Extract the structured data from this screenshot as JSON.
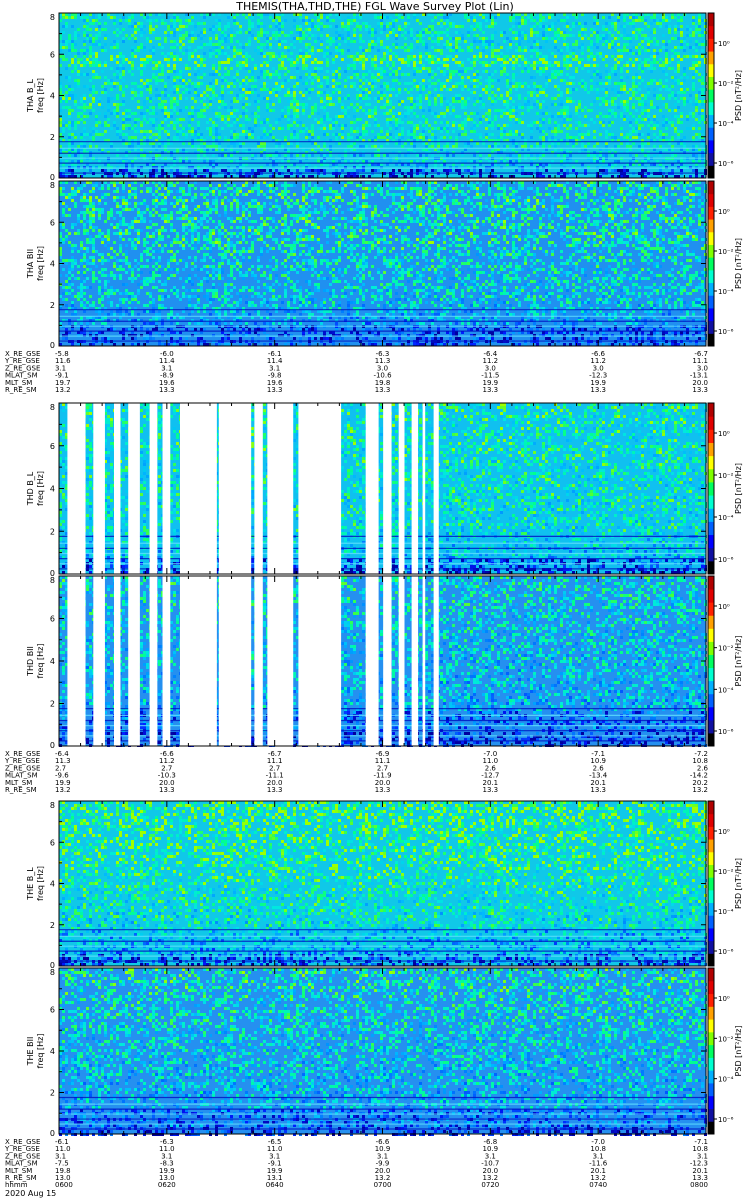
{
  "title": "THEMIS(THA,THD,THE) FGL Wave Survey Plot (Lin)",
  "date_label": "2020 Aug 15",
  "colorbar": {
    "label": "PSD [nT²/Hz]",
    "colors": [
      "#000000",
      "#1010a0",
      "#0000ff",
      "#0060ff",
      "#00b0ff",
      "#00ffd0",
      "#00ff60",
      "#80ff00",
      "#ffff00",
      "#ffa000",
      "#ff2000",
      "#e00000",
      "#b00000"
    ]
  },
  "time_axis": {
    "ticks": [
      "0600",
      "0620",
      "0640",
      "0700",
      "0720",
      "0740",
      "0800"
    ],
    "label": "hhmm"
  },
  "chart_data": [
    {
      "type": "heatmap",
      "panel": "THA B_L",
      "ylabel": "THA B_L freq [Hz]",
      "ylabel_top": "THA B_L",
      "ylabel_bottom": "freq [Hz]",
      "yticks": [
        "0",
        "2",
        "4",
        "6",
        "8"
      ],
      "ylim": [
        0,
        8
      ],
      "zticks": [
        "10⁰",
        "10⁻²",
        "10⁻⁴",
        "10⁻⁶"
      ],
      "zscale": "log",
      "style": "tha_bl",
      "bg": "#10c8e8",
      "gaps": []
    },
    {
      "type": "heatmap",
      "panel": "THA BII",
      "ylabel": "THA BII freq [Hz]",
      "ylabel_top": "THA BII",
      "ylabel_bottom": "freq [Hz]",
      "yticks": [
        "0",
        "2",
        "4",
        "6",
        "8"
      ],
      "ylim": [
        0,
        8
      ],
      "zticks": [
        "10⁰",
        "10⁻²",
        "10⁻⁴",
        "10⁻⁶"
      ],
      "zscale": "log",
      "style": "tha_bii",
      "bg": "#2090f0",
      "gaps": []
    },
    {
      "type": "heatmap",
      "panel": "THD B_L",
      "ylabel": "THD B_L freq [Hz]",
      "ylabel_top": "THD B_L",
      "ylabel_bottom": "freq [Hz]",
      "yticks": [
        "0",
        "2",
        "4",
        "6",
        "8"
      ],
      "ylim": [
        0,
        8
      ],
      "zticks": [
        "10⁰",
        "10⁻²",
        "10⁻⁴",
        "10⁻⁶"
      ],
      "zscale": "log",
      "style": "thd_bl",
      "bg": "#10c0f0",
      "gaps": [
        [
          0.013,
          0.041
        ],
        [
          0.053,
          0.071
        ],
        [
          0.085,
          0.095
        ],
        [
          0.107,
          0.125
        ],
        [
          0.14,
          0.152
        ],
        [
          0.16,
          0.172
        ],
        [
          0.187,
          0.244
        ],
        [
          0.247,
          0.297
        ],
        [
          0.302,
          0.315
        ],
        [
          0.322,
          0.362
        ],
        [
          0.37,
          0.436
        ],
        [
          0.474,
          0.494
        ],
        [
          0.501,
          0.514
        ],
        [
          0.525,
          0.534
        ],
        [
          0.545,
          0.555
        ],
        [
          0.562,
          0.566
        ],
        [
          0.579,
          0.587
        ]
      ]
    },
    {
      "type": "heatmap",
      "panel": "THD BII",
      "ylabel": "THD BII freq [Hz]",
      "ylabel_top": "THD BII",
      "ylabel_bottom": "freq [Hz]",
      "yticks": [
        "0",
        "2",
        "4",
        "6",
        "8"
      ],
      "ylim": [
        0,
        8
      ],
      "zticks": [
        "10⁰",
        "10⁻²",
        "10⁻⁴",
        "10⁻⁶"
      ],
      "zscale": "log",
      "style": "thd_bii",
      "bg": "#2590f0",
      "gaps": [
        [
          0.013,
          0.041
        ],
        [
          0.053,
          0.071
        ],
        [
          0.085,
          0.095
        ],
        [
          0.107,
          0.125
        ],
        [
          0.14,
          0.152
        ],
        [
          0.16,
          0.172
        ],
        [
          0.187,
          0.244
        ],
        [
          0.247,
          0.297
        ],
        [
          0.302,
          0.315
        ],
        [
          0.322,
          0.362
        ],
        [
          0.37,
          0.436
        ],
        [
          0.474,
          0.494
        ],
        [
          0.501,
          0.514
        ],
        [
          0.525,
          0.534
        ],
        [
          0.545,
          0.555
        ],
        [
          0.562,
          0.566
        ],
        [
          0.579,
          0.587
        ]
      ]
    },
    {
      "type": "heatmap",
      "panel": "THE B_L",
      "ylabel": "THE B_L freq [Hz]",
      "ylabel_top": "THE B_L",
      "ylabel_bottom": "freq [Hz]",
      "yticks": [
        "0",
        "2",
        "4",
        "6",
        "8"
      ],
      "ylim": [
        0,
        8
      ],
      "zticks": [
        "10⁰",
        "10⁻²",
        "10⁻⁴",
        "10⁻⁶"
      ],
      "zscale": "log",
      "style": "the_bl",
      "bg": "#10c8e8",
      "gaps": []
    },
    {
      "type": "heatmap",
      "panel": "THE BII",
      "ylabel": "THE BII freq [Hz]",
      "ylabel_top": "THE BII",
      "ylabel_bottom": "freq [Hz]",
      "yticks": [
        "0",
        "2",
        "4",
        "6",
        "8"
      ],
      "ylim": [
        0,
        8
      ],
      "zticks": [
        "10⁰",
        "10⁻²",
        "10⁻⁴",
        "10⁻⁶"
      ],
      "zscale": "log",
      "style": "the_bii",
      "bg": "#2590f0",
      "gaps": []
    }
  ],
  "ephemeris": [
    {
      "rows": [
        {
          "label": "X_RE_GSE",
          "values": [
            "-5.8",
            "-6.0",
            "-6.1",
            "-6.3",
            "-6.4",
            "-6.6",
            "-6.7"
          ]
        },
        {
          "label": "Y_RE_GSE",
          "values": [
            "11.6",
            "11.4",
            "11.4",
            "11.3",
            "11.2",
            "11.2",
            "11.1"
          ]
        },
        {
          "label": "Z_RE_GSE",
          "values": [
            "3.1",
            "3.1",
            "3.1",
            "3.0",
            "3.0",
            "3.0",
            "3.0"
          ]
        },
        {
          "label": "MLAT_SM",
          "values": [
            "-9.1",
            "-8.9",
            "-9.8",
            "-10.6",
            "-11.5",
            "-12.3",
            "-13.1"
          ]
        },
        {
          "label": "MLT_SM",
          "values": [
            "19.7",
            "19.6",
            "19.6",
            "19.8",
            "19.9",
            "19.9",
            "20.0"
          ]
        },
        {
          "label": "R_RE_SM",
          "values": [
            "13.2",
            "13.3",
            "13.3",
            "13.3",
            "13.3",
            "13.3",
            "13.3"
          ]
        }
      ]
    },
    {
      "rows": [
        {
          "label": "X_RE_GSE",
          "values": [
            "-6.4",
            "-6.6",
            "-6.7",
            "-6.9",
            "-7.0",
            "-7.1",
            "-7.2"
          ]
        },
        {
          "label": "Y_RE_GSE",
          "values": [
            "11.3",
            "11.2",
            "11.1",
            "11.1",
            "11.0",
            "10.9",
            "10.8"
          ]
        },
        {
          "label": "Z_RE_GSE",
          "values": [
            "2.7",
            "2.7",
            "2.7",
            "2.7",
            "2.6",
            "2.6",
            "2.6"
          ]
        },
        {
          "label": "MLAT_SM",
          "values": [
            "-9.6",
            "-10.3",
            "-11.1",
            "-11.9",
            "-12.7",
            "-13.4",
            "-14.2"
          ]
        },
        {
          "label": "MLT_SM",
          "values": [
            "19.9",
            "20.0",
            "20.0",
            "20.0",
            "20.1",
            "20.1",
            "20.2"
          ]
        },
        {
          "label": "R_RE_SM",
          "values": [
            "13.2",
            "13.3",
            "13.3",
            "13.3",
            "13.3",
            "13.3",
            "13.2"
          ]
        }
      ]
    },
    {
      "rows": [
        {
          "label": "X_RE_GSE",
          "values": [
            "-6.1",
            "-6.3",
            "-6.5",
            "-6.6",
            "-6.8",
            "-7.0",
            "-7.1"
          ]
        },
        {
          "label": "Y_RE_GSE",
          "values": [
            "11.0",
            "11.0",
            "11.0",
            "10.9",
            "10.9",
            "10.8",
            "10.8"
          ]
        },
        {
          "label": "Z_RE_GSE",
          "values": [
            "3.1",
            "3.1",
            "3.1",
            "3.1",
            "3.1",
            "3.1",
            "3.1"
          ]
        },
        {
          "label": "MLAT_SM",
          "values": [
            "-7.5",
            "-8.3",
            "-9.1",
            "-9.9",
            "-10.7",
            "-11.6",
            "-12.3"
          ]
        },
        {
          "label": "MLT_SM",
          "values": [
            "19.8",
            "19.9",
            "19.9",
            "20.0",
            "20.0",
            "20.1",
            "20.1"
          ]
        },
        {
          "label": "R_RE_SM",
          "values": [
            "13.0",
            "13.0",
            "13.1",
            "13.2",
            "13.2",
            "13.2",
            "13.3"
          ]
        }
      ]
    }
  ]
}
